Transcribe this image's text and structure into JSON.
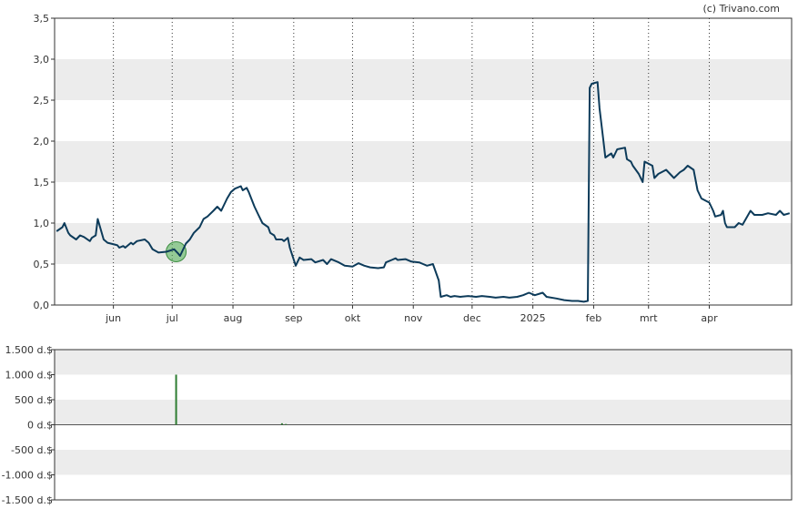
{
  "credit": "(c) Trivano.com",
  "chart_data": [
    {
      "type": "line",
      "x_tick_labels": [
        "jun",
        "jul",
        "aug",
        "sep",
        "okt",
        "nov",
        "dec",
        "2025",
        "feb",
        "mrt",
        "apr"
      ],
      "y_tick_labels": [
        "0,0",
        "0,5",
        "1,0",
        "1,5",
        "2,0",
        "2,5",
        "3,0",
        "3,5"
      ],
      "ylim": [
        0,
        3.5
      ],
      "grid": "vertical dotted lines at months, alternating gray horizontal bands",
      "colors": {
        "line": "#0d3b5a",
        "band": "#ececec",
        "marker": "#4caf50"
      },
      "marker": {
        "x": "2024-07-03",
        "y": 0.65
      },
      "series": [
        {
          "points": [
            [
              "2024-05-03",
              0.9
            ],
            [
              "2024-05-06",
              0.95
            ],
            [
              "2024-05-07",
              1.0
            ],
            [
              "2024-05-09",
              0.88
            ],
            [
              "2024-05-10",
              0.85
            ],
            [
              "2024-05-13",
              0.8
            ],
            [
              "2024-05-15",
              0.85
            ],
            [
              "2024-05-17",
              0.83
            ],
            [
              "2024-05-20",
              0.78
            ],
            [
              "2024-05-21",
              0.82
            ],
            [
              "2024-05-23",
              0.85
            ],
            [
              "2024-05-24",
              1.05
            ],
            [
              "2024-05-27",
              0.8
            ],
            [
              "2024-05-29",
              0.76
            ],
            [
              "2024-06-03",
              0.73
            ],
            [
              "2024-06-04",
              0.7
            ],
            [
              "2024-06-06",
              0.72
            ],
            [
              "2024-06-07",
              0.7
            ],
            [
              "2024-06-10",
              0.76
            ],
            [
              "2024-06-11",
              0.74
            ],
            [
              "2024-06-13",
              0.78
            ],
            [
              "2024-06-17",
              0.8
            ],
            [
              "2024-06-19",
              0.76
            ],
            [
              "2024-06-21",
              0.68
            ],
            [
              "2024-06-24",
              0.64
            ],
            [
              "2024-06-28",
              0.65
            ],
            [
              "2024-07-02",
              0.68
            ],
            [
              "2024-07-04",
              0.63
            ],
            [
              "2024-07-05",
              0.6
            ],
            [
              "2024-07-08",
              0.75
            ],
            [
              "2024-07-10",
              0.8
            ],
            [
              "2024-07-12",
              0.88
            ],
            [
              "2024-07-15",
              0.95
            ],
            [
              "2024-07-17",
              1.05
            ],
            [
              "2024-07-19",
              1.08
            ],
            [
              "2024-07-22",
              1.15
            ],
            [
              "2024-07-24",
              1.2
            ],
            [
              "2024-07-26",
              1.15
            ],
            [
              "2024-07-29",
              1.3
            ],
            [
              "2024-07-31",
              1.38
            ],
            [
              "2024-08-02",
              1.42
            ],
            [
              "2024-08-05",
              1.45
            ],
            [
              "2024-08-06",
              1.4
            ],
            [
              "2024-08-08",
              1.43
            ],
            [
              "2024-08-09",
              1.38
            ],
            [
              "2024-08-12",
              1.2
            ],
            [
              "2024-08-14",
              1.1
            ],
            [
              "2024-08-16",
              1.0
            ],
            [
              "2024-08-19",
              0.95
            ],
            [
              "2024-08-20",
              0.88
            ],
            [
              "2024-08-22",
              0.85
            ],
            [
              "2024-08-23",
              0.8
            ],
            [
              "2024-08-26",
              0.8
            ],
            [
              "2024-08-27",
              0.78
            ],
            [
              "2024-08-29",
              0.82
            ],
            [
              "2024-08-30",
              0.7
            ],
            [
              "2024-09-02",
              0.48
            ],
            [
              "2024-09-04",
              0.58
            ],
            [
              "2024-09-06",
              0.55
            ],
            [
              "2024-09-10",
              0.56
            ],
            [
              "2024-09-12",
              0.52
            ],
            [
              "2024-09-16",
              0.55
            ],
            [
              "2024-09-18",
              0.5
            ],
            [
              "2024-09-20",
              0.56
            ],
            [
              "2024-09-24",
              0.52
            ],
            [
              "2024-09-27",
              0.48
            ],
            [
              "2024-10-01",
              0.47
            ],
            [
              "2024-10-04",
              0.51
            ],
            [
              "2024-10-07",
              0.48
            ],
            [
              "2024-10-10",
              0.46
            ],
            [
              "2024-10-14",
              0.45
            ],
            [
              "2024-10-17",
              0.46
            ],
            [
              "2024-10-18",
              0.52
            ],
            [
              "2024-10-21",
              0.55
            ],
            [
              "2024-10-23",
              0.57
            ],
            [
              "2024-10-24",
              0.55
            ],
            [
              "2024-10-28",
              0.56
            ],
            [
              "2024-10-31",
              0.53
            ],
            [
              "2024-11-04",
              0.52
            ],
            [
              "2024-11-06",
              0.5
            ],
            [
              "2024-11-08",
              0.48
            ],
            [
              "2024-11-11",
              0.5
            ],
            [
              "2024-11-14",
              0.3
            ],
            [
              "2024-11-15",
              0.1
            ],
            [
              "2024-11-18",
              0.12
            ],
            [
              "2024-11-20",
              0.1
            ],
            [
              "2024-11-22",
              0.11
            ],
            [
              "2024-11-25",
              0.1
            ],
            [
              "2024-11-29",
              0.11
            ],
            [
              "2024-12-03",
              0.1
            ],
            [
              "2024-12-06",
              0.11
            ],
            [
              "2024-12-10",
              0.1
            ],
            [
              "2024-12-13",
              0.09
            ],
            [
              "2024-12-17",
              0.1
            ],
            [
              "2024-12-20",
              0.09
            ],
            [
              "2024-12-24",
              0.1
            ],
            [
              "2024-12-27",
              0.12
            ],
            [
              "2024-12-30",
              0.15
            ],
            [
              "2025-01-02",
              0.12
            ],
            [
              "2025-01-06",
              0.15
            ],
            [
              "2025-01-08",
              0.1
            ],
            [
              "2025-01-13",
              0.08
            ],
            [
              "2025-01-17",
              0.06
            ],
            [
              "2025-01-21",
              0.05
            ],
            [
              "2025-01-24",
              0.05
            ],
            [
              "2025-01-27",
              0.04
            ],
            [
              "2025-01-29",
              0.05
            ],
            [
              "2025-01-30",
              2.65
            ],
            [
              "2025-01-31",
              2.7
            ],
            [
              "2025-02-03",
              2.72
            ],
            [
              "2025-02-04",
              2.4
            ],
            [
              "2025-02-06",
              2.0
            ],
            [
              "2025-02-07",
              1.8
            ],
            [
              "2025-02-10",
              1.85
            ],
            [
              "2025-02-11",
              1.8
            ],
            [
              "2025-02-13",
              1.9
            ],
            [
              "2025-02-17",
              1.92
            ],
            [
              "2025-02-18",
              1.78
            ],
            [
              "2025-02-20",
              1.75
            ],
            [
              "2025-02-21",
              1.7
            ],
            [
              "2025-02-24",
              1.6
            ],
            [
              "2025-02-26",
              1.5
            ],
            [
              "2025-02-27",
              1.75
            ],
            [
              "2025-03-03",
              1.7
            ],
            [
              "2025-03-04",
              1.55
            ],
            [
              "2025-03-06",
              1.6
            ],
            [
              "2025-03-10",
              1.65
            ],
            [
              "2025-03-12",
              1.6
            ],
            [
              "2025-03-14",
              1.55
            ],
            [
              "2025-03-17",
              1.62
            ],
            [
              "2025-03-19",
              1.65
            ],
            [
              "2025-03-21",
              1.7
            ],
            [
              "2025-03-24",
              1.65
            ],
            [
              "2025-03-26",
              1.4
            ],
            [
              "2025-03-28",
              1.3
            ],
            [
              "2025-04-01",
              1.25
            ],
            [
              "2025-04-03",
              1.15
            ],
            [
              "2025-04-04",
              1.08
            ],
            [
              "2025-04-07",
              1.1
            ],
            [
              "2025-04-08",
              1.15
            ],
            [
              "2025-04-09",
              1.0
            ],
            [
              "2025-04-10",
              0.95
            ],
            [
              "2025-04-14",
              0.95
            ],
            [
              "2025-04-16",
              1.0
            ],
            [
              "2025-04-18",
              0.98
            ],
            [
              "2025-04-22",
              1.15
            ],
            [
              "2025-04-24",
              1.1
            ],
            [
              "2025-04-28",
              1.1
            ],
            [
              "2025-05-01",
              1.12
            ],
            [
              "2025-05-05",
              1.1
            ],
            [
              "2025-05-07",
              1.15
            ],
            [
              "2025-05-09",
              1.1
            ],
            [
              "2025-05-12",
              1.12
            ]
          ]
        }
      ]
    },
    {
      "type": "bar",
      "y_tick_labels": [
        "1.500 d.$",
        "1.000 d.$",
        "500 d.$",
        "0 d.$",
        "-500 d.$",
        "-1.000 d.$",
        "-1.500 d.$"
      ],
      "ylim": [
        -1500,
        1500
      ],
      "grid": "alternating gray horizontal bands",
      "colors": {
        "bar": "#2e7d32",
        "band": "#ececec",
        "zero_line": "#555555"
      },
      "bars": [
        {
          "x": "2024-07-03",
          "value": 1000
        },
        {
          "x": "2024-08-26",
          "value": 30
        },
        {
          "x": "2024-08-28",
          "value": 15
        }
      ]
    }
  ]
}
